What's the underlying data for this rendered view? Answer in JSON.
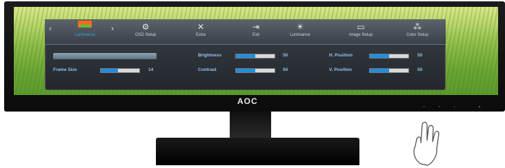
{
  "brand_logo": "AOC",
  "osd": {
    "selected_tab": "Luminance",
    "tabs": [
      {
        "label": "Luminance",
        "icon": "luminance-icon"
      },
      {
        "label": "OSD Setup",
        "icon": "osd-setup-icon"
      },
      {
        "label": "Extra",
        "icon": "extra-icon"
      },
      {
        "label": "Exit",
        "icon": "exit-icon"
      },
      {
        "label": "Luminance",
        "icon": "sun-icon"
      },
      {
        "label": "Image Setup",
        "icon": "image-setup-icon"
      },
      {
        "label": "Color Setup",
        "icon": "color-setup-icon"
      }
    ],
    "left_col": {
      "highlight_text": "",
      "frame_size_label": "Frame Size",
      "frame_size_value": "14",
      "frame_size_level": 0.45
    },
    "mid_col": {
      "brightness_label": "Brightness",
      "brightness_value": "50",
      "brightness_level": 0.5,
      "contrast_label": "Contrast",
      "contrast_value": "50",
      "contrast_level": 0.5
    },
    "right_col": {
      "hpos_label": "H. Position",
      "hpos_value": "50",
      "hpos_level": 0.5,
      "vpos_label": "V. Position",
      "vpos_value": "50",
      "vpos_level": 0.5
    }
  },
  "colors": {
    "accent_blue": "#1e8fe0",
    "selected_orange": "#ff6a1c"
  }
}
